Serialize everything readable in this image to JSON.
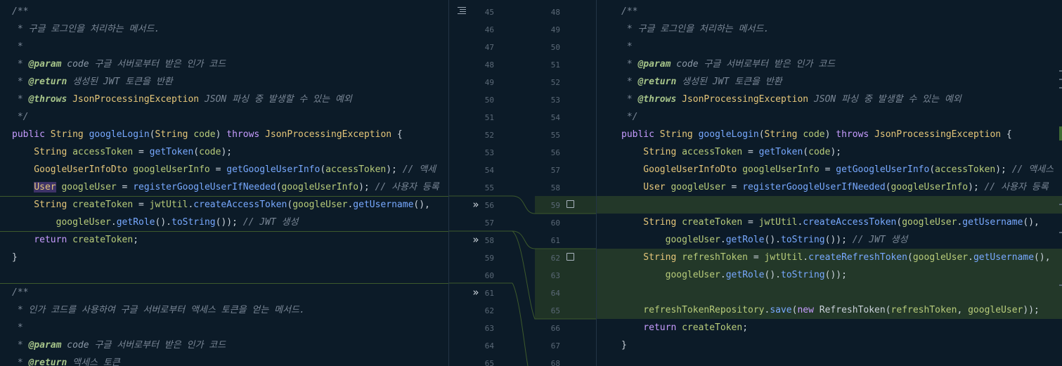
{
  "left": {
    "lines": [
      {
        "tokens": [
          {
            "t": "/**",
            "c": "c-comment"
          }
        ]
      },
      {
        "tokens": [
          {
            "t": " * 구글 로그인을 처리하는 메서드.",
            "c": "c-comment"
          }
        ]
      },
      {
        "tokens": [
          {
            "t": " *",
            "c": "c-comment"
          }
        ]
      },
      {
        "tokens": [
          {
            "t": " * ",
            "c": "c-comment"
          },
          {
            "t": "@param",
            "c": "c-tag"
          },
          {
            "t": " code",
            "c": "c-param"
          },
          {
            "t": " 구글 서버로부터 받은 인가 코드",
            "c": "c-comment"
          }
        ]
      },
      {
        "tokens": [
          {
            "t": " * ",
            "c": "c-comment"
          },
          {
            "t": "@return",
            "c": "c-tag"
          },
          {
            "t": " 생성된 JWT 토큰을 반환",
            "c": "c-comment"
          }
        ]
      },
      {
        "tokens": [
          {
            "t": " * ",
            "c": "c-comment"
          },
          {
            "t": "@throws",
            "c": "c-tag"
          },
          {
            "t": " JsonProcessingException",
            "c": "c-type"
          },
          {
            "t": " JSON 파싱 중 발생할 수 있는 예외",
            "c": "c-comment"
          }
        ]
      },
      {
        "tokens": [
          {
            "t": " */",
            "c": "c-comment"
          }
        ]
      },
      {
        "tokens": [
          {
            "t": "public ",
            "c": "c-kw"
          },
          {
            "t": "String ",
            "c": "c-type"
          },
          {
            "t": "googleLogin",
            "c": "c-fn"
          },
          {
            "t": "(",
            "c": "c-text"
          },
          {
            "t": "String ",
            "c": "c-type"
          },
          {
            "t": "code",
            "c": "c-var"
          },
          {
            "t": ") ",
            "c": "c-text"
          },
          {
            "t": "throws ",
            "c": "c-kw"
          },
          {
            "t": "JsonProcessingException",
            "c": "c-type"
          },
          {
            "t": " {",
            "c": "c-text"
          }
        ]
      },
      {
        "tokens": [
          {
            "t": "    String ",
            "c": "c-type"
          },
          {
            "t": "accessToken",
            "c": "c-var"
          },
          {
            "t": " = ",
            "c": "c-text"
          },
          {
            "t": "getToken",
            "c": "c-fn"
          },
          {
            "t": "(",
            "c": "c-text"
          },
          {
            "t": "code",
            "c": "c-var"
          },
          {
            "t": ");",
            "c": "c-text"
          }
        ]
      },
      {
        "tokens": [
          {
            "t": "    GoogleUserInfoDto ",
            "c": "c-type"
          },
          {
            "t": "googleUserInfo",
            "c": "c-var"
          },
          {
            "t": " = ",
            "c": "c-text"
          },
          {
            "t": "getGoogleUserInfo",
            "c": "c-fn"
          },
          {
            "t": "(",
            "c": "c-text"
          },
          {
            "t": "accessToken",
            "c": "c-var"
          },
          {
            "t": "); ",
            "c": "c-text"
          },
          {
            "t": "// 액세",
            "c": "c-comment"
          }
        ]
      },
      {
        "tokens": [
          {
            "t": "    ",
            "c": "c-text"
          },
          {
            "t": "User",
            "c": "c-sel"
          },
          {
            "t": " googleUser",
            "c": "c-var"
          },
          {
            "t": " = ",
            "c": "c-text"
          },
          {
            "t": "registerGoogleUserIfNeeded",
            "c": "c-fn"
          },
          {
            "t": "(",
            "c": "c-text"
          },
          {
            "t": "googleUserInfo",
            "c": "c-var"
          },
          {
            "t": "); ",
            "c": "c-text"
          },
          {
            "t": "// 사용자 등록",
            "c": "c-comment"
          }
        ]
      },
      {
        "tokens": [
          {
            "t": "    String ",
            "c": "c-type"
          },
          {
            "t": "createToken",
            "c": "c-var"
          },
          {
            "t": " = ",
            "c": "c-text"
          },
          {
            "t": "jwtUtil",
            "c": "c-field"
          },
          {
            "t": ".",
            "c": "c-text"
          },
          {
            "t": "createAccessToken",
            "c": "c-fn"
          },
          {
            "t": "(",
            "c": "c-text"
          },
          {
            "t": "googleUser",
            "c": "c-var"
          },
          {
            "t": ".",
            "c": "c-text"
          },
          {
            "t": "getUsername",
            "c": "c-fn"
          },
          {
            "t": "(),",
            "c": "c-text"
          }
        ]
      },
      {
        "tokens": [
          {
            "t": "        googleUser",
            "c": "c-var"
          },
          {
            "t": ".",
            "c": "c-text"
          },
          {
            "t": "getRole",
            "c": "c-fn"
          },
          {
            "t": "().",
            "c": "c-text"
          },
          {
            "t": "toString",
            "c": "c-fn"
          },
          {
            "t": "()); ",
            "c": "c-text"
          },
          {
            "t": "// JWT 생성",
            "c": "c-comment"
          }
        ]
      },
      {
        "tokens": [
          {
            "t": "    return ",
            "c": "c-kw"
          },
          {
            "t": "createToken",
            "c": "c-var"
          },
          {
            "t": ";",
            "c": "c-text"
          }
        ]
      },
      {
        "tokens": [
          {
            "t": "}",
            "c": "c-text"
          }
        ]
      },
      {
        "tokens": [
          {
            "t": "",
            "c": "c-text"
          }
        ]
      },
      {
        "tokens": [
          {
            "t": "/**",
            "c": "c-comment"
          }
        ]
      },
      {
        "tokens": [
          {
            "t": " * 인가 코드를 사용하여 구글 서버로부터 액세스 토큰을 얻는 메서드.",
            "c": "c-comment"
          }
        ]
      },
      {
        "tokens": [
          {
            "t": " *",
            "c": "c-comment"
          }
        ]
      },
      {
        "tokens": [
          {
            "t": " * ",
            "c": "c-comment"
          },
          {
            "t": "@param",
            "c": "c-tag"
          },
          {
            "t": " code",
            "c": "c-param"
          },
          {
            "t": " 구글 서버로부터 받은 인가 코드",
            "c": "c-comment"
          }
        ]
      },
      {
        "tokens": [
          {
            "t": " * ",
            "c": "c-comment"
          },
          {
            "t": "@return",
            "c": "c-tag"
          },
          {
            "t": " 액세스 토큰",
            "c": "c-comment"
          }
        ]
      }
    ]
  },
  "right": {
    "lines": [
      {
        "tokens": [
          {
            "t": "/**",
            "c": "c-comment"
          }
        ]
      },
      {
        "tokens": [
          {
            "t": " * 구글 로그인을 처리하는 메서드.",
            "c": "c-comment"
          }
        ]
      },
      {
        "tokens": [
          {
            "t": " *",
            "c": "c-comment"
          }
        ]
      },
      {
        "tokens": [
          {
            "t": " * ",
            "c": "c-comment"
          },
          {
            "t": "@param",
            "c": "c-tag"
          },
          {
            "t": " code",
            "c": "c-param"
          },
          {
            "t": " 구글 서버로부터 받은 인가 코드",
            "c": "c-comment"
          }
        ]
      },
      {
        "tokens": [
          {
            "t": " * ",
            "c": "c-comment"
          },
          {
            "t": "@return",
            "c": "c-tag"
          },
          {
            "t": " 생성된 JWT 토큰을 반환",
            "c": "c-comment"
          }
        ]
      },
      {
        "tokens": [
          {
            "t": " * ",
            "c": "c-comment"
          },
          {
            "t": "@throws",
            "c": "c-tag"
          },
          {
            "t": " JsonProcessingException",
            "c": "c-type"
          },
          {
            "t": " JSON 파싱 중 발생할 수 있는 예외",
            "c": "c-comment"
          }
        ]
      },
      {
        "tokens": [
          {
            "t": " */",
            "c": "c-comment"
          }
        ]
      },
      {
        "tokens": [
          {
            "t": "public ",
            "c": "c-kw"
          },
          {
            "t": "String ",
            "c": "c-type"
          },
          {
            "t": "googleLogin",
            "c": "c-fn"
          },
          {
            "t": "(",
            "c": "c-text"
          },
          {
            "t": "String ",
            "c": "c-type"
          },
          {
            "t": "code",
            "c": "c-var"
          },
          {
            "t": ") ",
            "c": "c-text"
          },
          {
            "t": "throws ",
            "c": "c-kw"
          },
          {
            "t": "JsonProcessingException",
            "c": "c-type"
          },
          {
            "t": " {",
            "c": "c-text"
          }
        ]
      },
      {
        "tokens": [
          {
            "t": "    String ",
            "c": "c-type"
          },
          {
            "t": "accessToken",
            "c": "c-var"
          },
          {
            "t": " = ",
            "c": "c-text"
          },
          {
            "t": "getToken",
            "c": "c-fn"
          },
          {
            "t": "(",
            "c": "c-text"
          },
          {
            "t": "code",
            "c": "c-var"
          },
          {
            "t": ");",
            "c": "c-text"
          }
        ]
      },
      {
        "tokens": [
          {
            "t": "    GoogleUserInfoDto ",
            "c": "c-type"
          },
          {
            "t": "googleUserInfo",
            "c": "c-var"
          },
          {
            "t": " = ",
            "c": "c-text"
          },
          {
            "t": "getGoogleUserInfo",
            "c": "c-fn"
          },
          {
            "t": "(",
            "c": "c-text"
          },
          {
            "t": "accessToken",
            "c": "c-var"
          },
          {
            "t": "); ",
            "c": "c-text"
          },
          {
            "t": "// 액세스",
            "c": "c-comment"
          }
        ]
      },
      {
        "tokens": [
          {
            "t": "    User ",
            "c": "c-type"
          },
          {
            "t": "googleUser",
            "c": "c-var"
          },
          {
            "t": " = ",
            "c": "c-text"
          },
          {
            "t": "registerGoogleUserIfNeeded",
            "c": "c-fn"
          },
          {
            "t": "(",
            "c": "c-text"
          },
          {
            "t": "googleUserInfo",
            "c": "c-var"
          },
          {
            "t": "); ",
            "c": "c-text"
          },
          {
            "t": "// 사용자 등록",
            "c": "c-comment"
          }
        ]
      },
      {
        "tokens": [
          {
            "t": "",
            "c": "c-text"
          }
        ]
      },
      {
        "tokens": [
          {
            "t": "    String ",
            "c": "c-type"
          },
          {
            "t": "createToken",
            "c": "c-var"
          },
          {
            "t": " = ",
            "c": "c-text"
          },
          {
            "t": "jwtUtil",
            "c": "c-field"
          },
          {
            "t": ".",
            "c": "c-text"
          },
          {
            "t": "createAccessToken",
            "c": "c-fn"
          },
          {
            "t": "(",
            "c": "c-text"
          },
          {
            "t": "googleUser",
            "c": "c-var"
          },
          {
            "t": ".",
            "c": "c-text"
          },
          {
            "t": "getUsername",
            "c": "c-fn"
          },
          {
            "t": "(),",
            "c": "c-text"
          }
        ]
      },
      {
        "tokens": [
          {
            "t": "        googleUser",
            "c": "c-var"
          },
          {
            "t": ".",
            "c": "c-text"
          },
          {
            "t": "getRole",
            "c": "c-fn"
          },
          {
            "t": "().",
            "c": "c-text"
          },
          {
            "t": "toString",
            "c": "c-fn"
          },
          {
            "t": "()); ",
            "c": "c-text"
          },
          {
            "t": "// JWT 생성",
            "c": "c-comment"
          }
        ]
      },
      {
        "tokens": [
          {
            "t": "    String ",
            "c": "c-type"
          },
          {
            "t": "refreshToken",
            "c": "c-var"
          },
          {
            "t": " = ",
            "c": "c-text"
          },
          {
            "t": "jwtUtil",
            "c": "c-field"
          },
          {
            "t": ".",
            "c": "c-text"
          },
          {
            "t": "createRefreshToken",
            "c": "c-fn"
          },
          {
            "t": "(",
            "c": "c-text"
          },
          {
            "t": "googleUser",
            "c": "c-var"
          },
          {
            "t": ".",
            "c": "c-text"
          },
          {
            "t": "getUsername",
            "c": "c-fn"
          },
          {
            "t": "(),",
            "c": "c-text"
          }
        ]
      },
      {
        "tokens": [
          {
            "t": "        googleUser",
            "c": "c-var"
          },
          {
            "t": ".",
            "c": "c-text"
          },
          {
            "t": "getRole",
            "c": "c-fn"
          },
          {
            "t": "().",
            "c": "c-text"
          },
          {
            "t": "toString",
            "c": "c-fn"
          },
          {
            "t": "());",
            "c": "c-text"
          }
        ]
      },
      {
        "tokens": [
          {
            "t": "",
            "c": "c-text"
          }
        ]
      },
      {
        "tokens": [
          {
            "t": "    refreshTokenRepository",
            "c": "c-field"
          },
          {
            "t": ".",
            "c": "c-text"
          },
          {
            "t": "save",
            "c": "c-fn"
          },
          {
            "t": "(",
            "c": "c-text"
          },
          {
            "t": "new ",
            "c": "c-kw"
          },
          {
            "t": "RefreshToken",
            "c": "c-text"
          },
          {
            "t": "(",
            "c": "c-text"
          },
          {
            "t": "refreshToken",
            "c": "c-var"
          },
          {
            "t": ", ",
            "c": "c-text"
          },
          {
            "t": "googleUser",
            "c": "c-var"
          },
          {
            "t": "));",
            "c": "c-text"
          }
        ]
      },
      {
        "tokens": [
          {
            "t": "    return ",
            "c": "c-kw"
          },
          {
            "t": "createToken",
            "c": "c-var"
          },
          {
            "t": ";",
            "c": "c-text"
          }
        ]
      },
      {
        "tokens": [
          {
            "t": "}",
            "c": "c-text"
          }
        ]
      },
      {
        "tokens": [
          {
            "t": "",
            "c": "c-text"
          }
        ]
      }
    ]
  },
  "gutter": {
    "left_numbers": [
      "45",
      "46",
      "47",
      "48",
      "49",
      "50",
      "51",
      "52",
      "53",
      "54",
      "55",
      "56",
      "57",
      "58",
      "59",
      "60",
      "61",
      "62",
      "63",
      "64",
      "65"
    ],
    "right_numbers": [
      "48",
      "49",
      "50",
      "51",
      "52",
      "53",
      "54",
      "55",
      "56",
      "57",
      "58",
      "59",
      "60",
      "61",
      "62",
      "63",
      "64",
      "65",
      "66",
      "67",
      "68"
    ],
    "arrow_glyph": "»",
    "arrow_icon": "apply-change-arrow-icon",
    "checkbox_icon": "accept-change-checkbox-icon",
    "menu_icon": "diff-settings-icon"
  },
  "colors": {
    "background": "#0c1b28",
    "added_highlight": "#233829",
    "diff_connector": "#3d5a2c"
  }
}
